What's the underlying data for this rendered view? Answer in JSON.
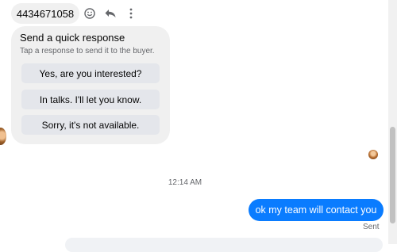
{
  "thread": {
    "top_message": "4434671058",
    "actions": {
      "react_icon": "smiley-icon",
      "reply_icon": "reply-arrow-icon",
      "more_icon": "vertical-dots-icon"
    },
    "timestamp": "12:14 AM",
    "outgoing_message": "ok my team will contact you",
    "status": "Sent"
  },
  "quick_response": {
    "title": "Send a quick response",
    "subtitle": "Tap a response to send it to the buyer.",
    "options": [
      "Yes, are you interested?",
      "In talks. I'll let you know.",
      "Sorry, it's not available."
    ]
  },
  "colors": {
    "bubble_incoming": "#f0f0f0",
    "bubble_outgoing": "#0a7cff",
    "quick_button": "#e4e6eb",
    "muted_text": "#65676b"
  }
}
